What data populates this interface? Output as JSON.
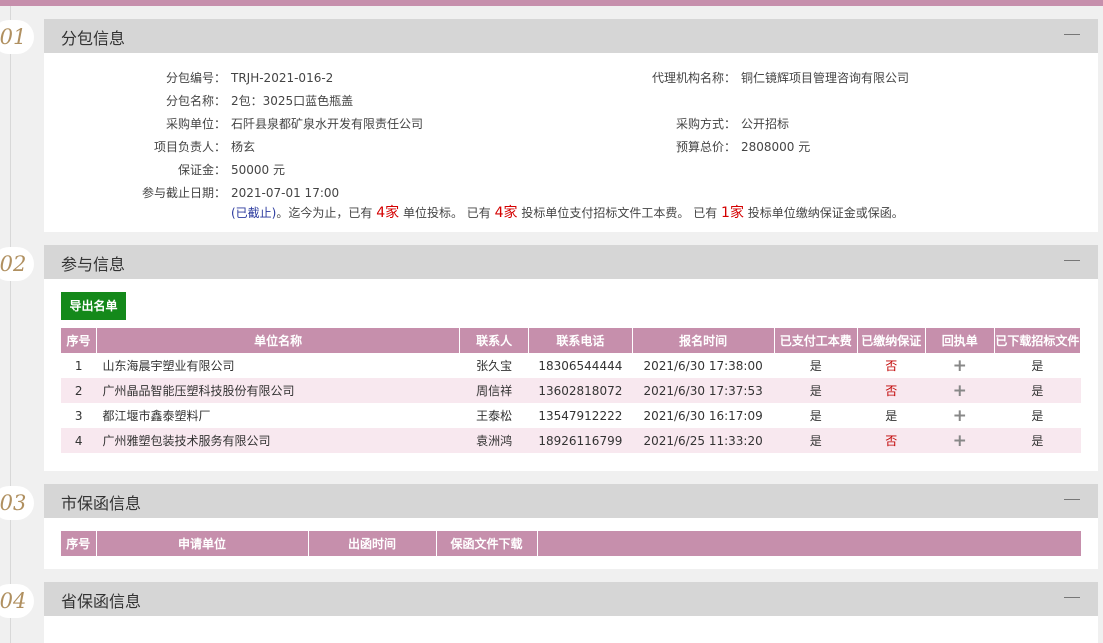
{
  "sections": [
    {
      "num": "01",
      "title": "分包信息"
    },
    {
      "num": "02",
      "title": "参与信息"
    },
    {
      "num": "03",
      "title": "市保函信息"
    },
    {
      "num": "04",
      "title": "省保函信息"
    }
  ],
  "package": {
    "code_label": "分包编号：",
    "code": "TRJH-2021-016-2",
    "name_label": "分包名称：",
    "name": "2包：3025口蓝色瓶盖",
    "buyer_label": "采购单位：",
    "buyer": "石阡县泉都矿泉水开发有限责任公司",
    "manager_label": "项目负责人：",
    "manager": "杨玄",
    "deposit_label": "保证金：",
    "deposit": "50000 元",
    "deadline_label": "参与截止日期：",
    "deadline": "2021-07-01 17:00",
    "agency_label": "代理机构名称：",
    "agency": "铜仁镜辉项目管理咨询有限公司",
    "method_label": "采购方式：",
    "method": "公开招标",
    "budget_label": "预算总价：",
    "budget": "2808000 元",
    "status": {
      "closed": "(已截止)",
      "t1": "。迄今为止，已有",
      "n1": "4家",
      "t2": "单位投标。 已有",
      "n2": "4家",
      "t3": "投标单位支付招标文件工本费。 已有",
      "n3": "1家",
      "t4": "投标单位缴纳保证金或保函。"
    }
  },
  "participants": {
    "export_label": "导出名单",
    "headers": [
      "序号",
      "单位名称",
      "联系人",
      "联系电话",
      "报名时间",
      "已支付工本费",
      "已缴纳保证",
      "回执单",
      "已下载招标文件"
    ],
    "rows": [
      {
        "no": "1",
        "company": "山东海晨宇塑业有限公司",
        "contact": "张久宝",
        "phone": "18306544444",
        "time": "2021/6/30 17:38:00",
        "paid": "是",
        "deposit": "否",
        "receipt": "+",
        "downloaded": "是"
      },
      {
        "no": "2",
        "company": "广州晶品智能压塑科技股份有限公司",
        "contact": "周信祥",
        "phone": "13602818072",
        "time": "2021/6/30 17:37:53",
        "paid": "是",
        "deposit": "否",
        "receipt": "+",
        "downloaded": "是"
      },
      {
        "no": "3",
        "company": "都江堰市鑫泰塑料厂",
        "contact": "王泰松",
        "phone": "13547912222",
        "time": "2021/6/30 16:17:09",
        "paid": "是",
        "deposit": "是",
        "receipt": "+",
        "downloaded": "是"
      },
      {
        "no": "4",
        "company": "广州雅塑包装技术服务有限公司",
        "contact": "袁洲鸿",
        "phone": "18926116799",
        "time": "2021/6/25 11:33:20",
        "paid": "是",
        "deposit": "否",
        "receipt": "+",
        "downloaded": "是"
      }
    ]
  },
  "city_guarantee": {
    "headers": [
      "序号",
      "申请单位",
      "出函时间",
      "保函文件下载"
    ]
  },
  "colors": {
    "accent": "#c68fac",
    "export": "#14891a",
    "count": "#d40000",
    "link": "#2b3a9e"
  }
}
